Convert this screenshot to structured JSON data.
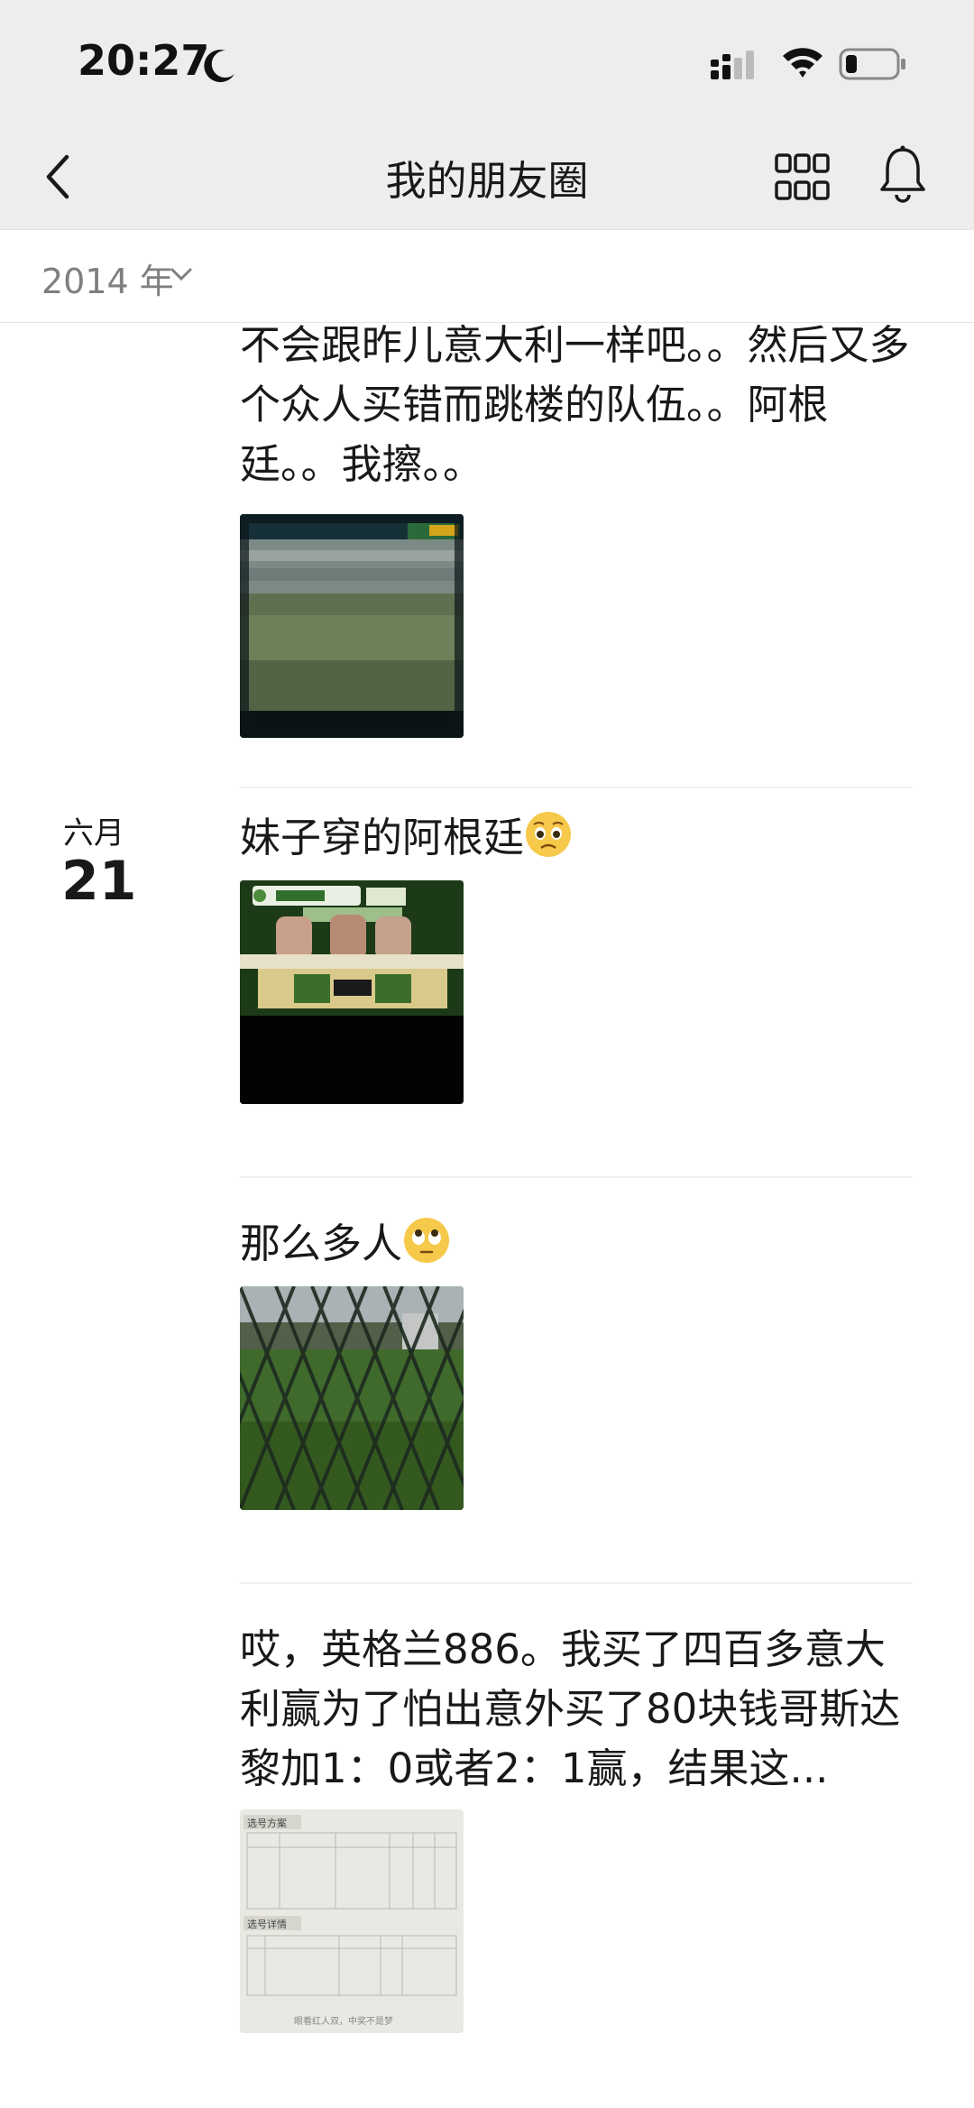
{
  "status_bar": {
    "time": "20:27"
  },
  "nav": {
    "title": "我的朋友圈"
  },
  "year_filter": {
    "label": "2014 年"
  },
  "posts": [
    {
      "text": "不会跟昨儿意大利一样吧。。然后又多个众人买错而跳楼的队伍。。阿根廷。。我擦。。",
      "image": "football-stadium-tv-photo"
    },
    {
      "date_month": "六月",
      "date_day": "21",
      "text": "妹子穿的阿根廷",
      "emoji": "pleading-face",
      "image": "tv-broadcast-studio-photo"
    },
    {
      "text": "那么多人",
      "emoji": "rolling-eyes-face",
      "image": "fence-football-field-photo"
    },
    {
      "text": "哎，英格兰886。我买了四百多意大利赢为了怕出意外买了80块钱哥斯达黎加1：0或者2：1赢，结果这...",
      "image": "lottery-ticket-photo",
      "ticket": {
        "section1": "选号方案",
        "section2": "选号详情",
        "footer": "眼看红人双，中奖不是梦"
      }
    }
  ],
  "colors": {
    "header_bg": "#ededed",
    "text": "#191919",
    "muted": "#7f7f7f",
    "divider": "#efefef"
  }
}
